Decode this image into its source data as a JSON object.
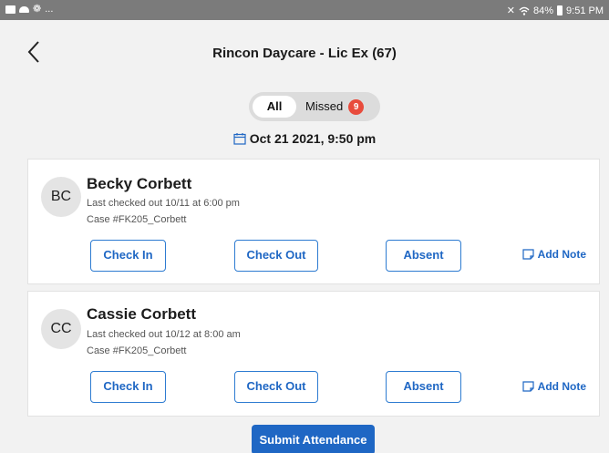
{
  "status_bar": {
    "left_icons": [
      "image-icon",
      "cloud-icon",
      "fan-icon"
    ],
    "left_more": "...",
    "right_text": "84%",
    "time": "9:51 PM",
    "right_icons": [
      "mute-icon",
      "wifi-icon",
      "battery-icon"
    ]
  },
  "header": {
    "title": "Rincon Daycare - Lic Ex (67)"
  },
  "filter": {
    "all_label": "All",
    "missed_label": "Missed",
    "missed_count": "9"
  },
  "date": {
    "value": "Oct 21 2021, 9:50 pm"
  },
  "children": [
    {
      "initials": "BC",
      "name": "Becky Corbett",
      "last_checked": "Last checked out 10/11 at 6:00 pm",
      "case": "Case #FK205_Corbett",
      "check_in": "Check In",
      "check_out": "Check Out",
      "absent": "Absent",
      "add_note": "Add Note"
    },
    {
      "initials": "CC",
      "name": "Cassie Corbett",
      "last_checked": "Last checked out 10/12 at 8:00 am",
      "case": "Case #FK205_Corbett",
      "check_in": "Check In",
      "check_out": "Check Out",
      "absent": "Absent",
      "add_note": "Add Note"
    }
  ],
  "submit_label": "Submit Attendance",
  "colors": {
    "accent": "#1f67c4",
    "badge": "#e84b3c",
    "status_bar": "#7b7b7b"
  }
}
